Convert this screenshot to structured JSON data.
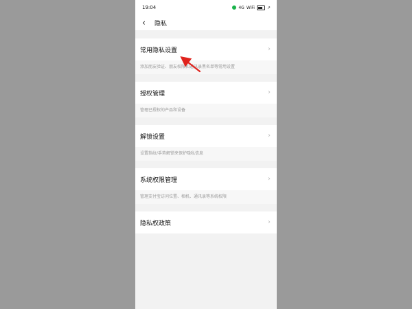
{
  "status_bar": {
    "time": "19:04",
    "network": "4G",
    "wifi": "WiFi",
    "signal": "↗"
  },
  "header": {
    "back_icon": "‹",
    "title": "隐私"
  },
  "items": [
    {
      "label": "常用隐私设置",
      "description": "添加朋友验证、朋友权限和通讯录黑名单等常用设置",
      "chevron": "›"
    },
    {
      "label": "授权管理",
      "description": "管理已授权的产品和设备",
      "chevron": "›"
    },
    {
      "label": "解锁设置",
      "description": "设置指纹/手势解锁来保护隐私信息",
      "chevron": "›"
    },
    {
      "label": "系统权限管理",
      "description": "管理支付宝访问位置、相机、通讯录等系统权限",
      "chevron": "›"
    },
    {
      "label": "隐私权政策",
      "chevron": "›"
    }
  ],
  "colors": {
    "outer_background": "#9a9a9a",
    "screen_background": "#f2f2f2",
    "annotation_arrow": "#e0231d"
  },
  "icons": [
    "back-arrow-icon",
    "chevron-right-icon",
    "annotation-arrow-icon"
  ]
}
